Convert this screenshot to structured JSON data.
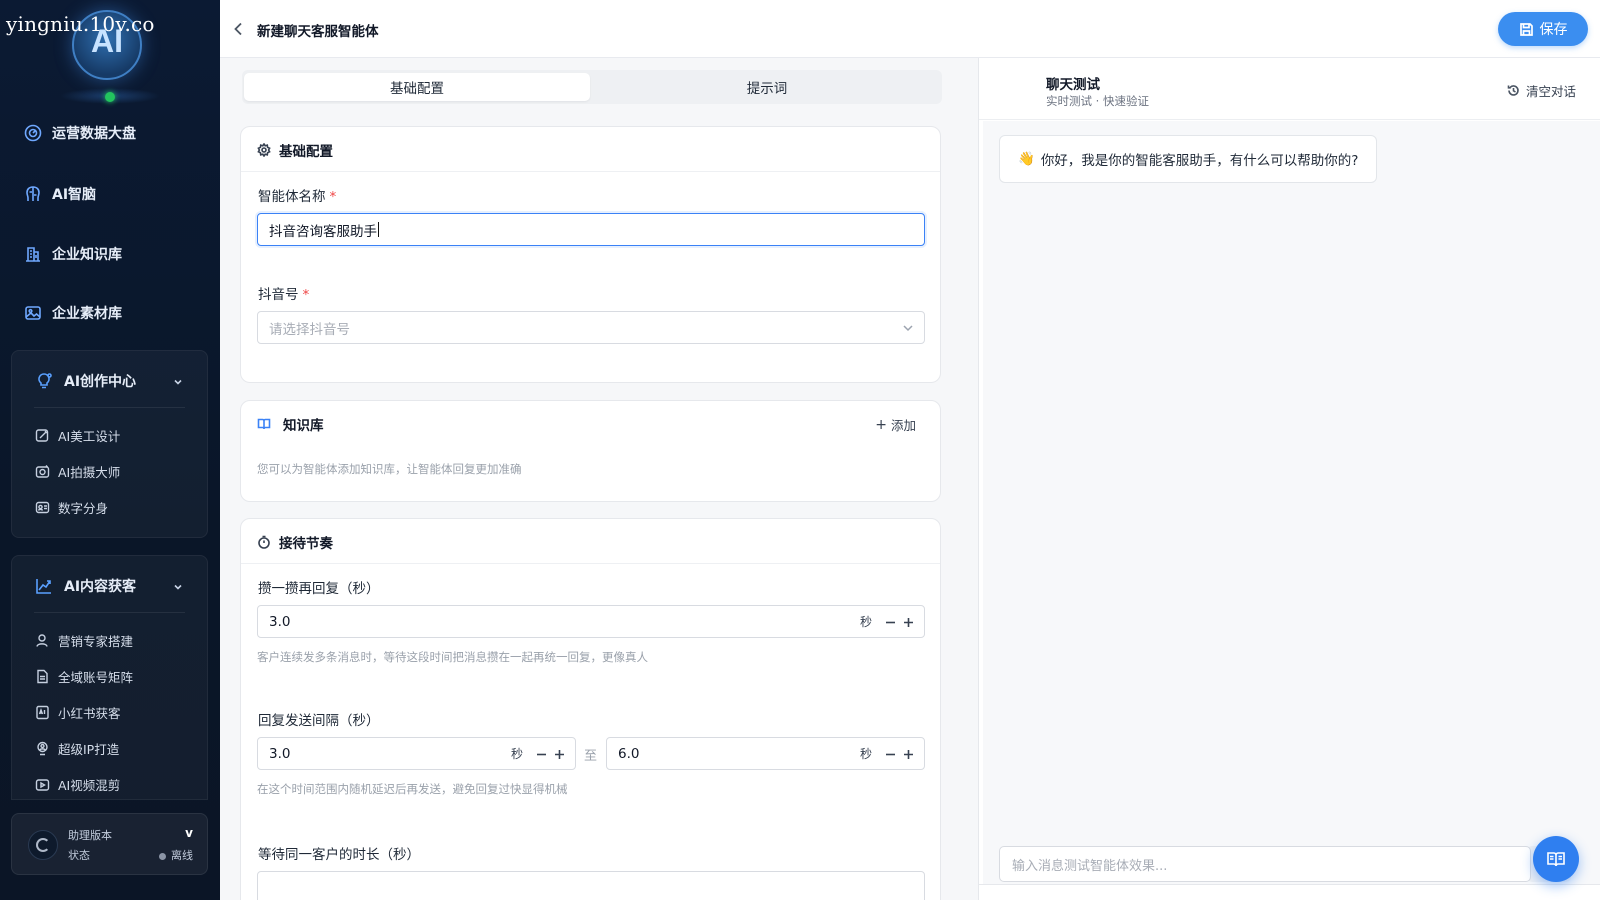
{
  "watermark": "yingniu.10v.co",
  "logo_text": "AI",
  "sidebar": {
    "items": [
      {
        "label": "运营数据大盘",
        "icon": "dashboard-icon"
      },
      {
        "label": "AI智脑",
        "icon": "brain-icon"
      },
      {
        "label": "企业知识库",
        "icon": "building-icon"
      },
      {
        "label": "企业素材库",
        "icon": "image-icon"
      }
    ],
    "groups": [
      {
        "label": "AI创作中心",
        "icon": "bulb-icon",
        "expanded": true,
        "items": [
          {
            "label": "AI美工设计",
            "icon": "design-icon"
          },
          {
            "label": "AI拍摄大师",
            "icon": "camera-icon"
          },
          {
            "label": "数字分身",
            "icon": "id-card-icon"
          }
        ]
      },
      {
        "label": "AI内容获客",
        "icon": "trend-icon",
        "expanded": true,
        "items": [
          {
            "label": "营销专家搭建",
            "icon": "user-icon"
          },
          {
            "label": "全域账号矩阵",
            "icon": "document-icon"
          },
          {
            "label": "小红书获客",
            "icon": "ai-doc-icon"
          },
          {
            "label": "超级IP打造",
            "icon": "monitor-icon"
          },
          {
            "label": "AI视频混剪",
            "icon": "video-icon"
          }
        ]
      }
    ],
    "assistant": {
      "version_label": "助理版本",
      "version_value": "v",
      "status_label": "状态",
      "status_value": "离线"
    }
  },
  "header": {
    "title": "新建聊天客服智能体",
    "save_label": "保存"
  },
  "tabs": [
    {
      "label": "基础配置",
      "active": true
    },
    {
      "label": "提示词",
      "active": false
    }
  ],
  "basic_config": {
    "title": "基础配置",
    "name_label": "智能体名称",
    "name_value": "抖音咨询客服助手",
    "douyin_label": "抖音号",
    "douyin_placeholder": "请选择抖音号",
    "required_mark": "*"
  },
  "knowledge": {
    "title": "知识库",
    "add_label": "添加",
    "hint": "您可以为智能体添加知识库，让智能体回复更加准确"
  },
  "rhythm": {
    "title": "接待节奏",
    "merge_label": "攒一攒再回复（秒）",
    "merge_value": "3.0",
    "merge_hint": "客户连续发多条消息时，等待这段时间把消息攒在一起再统一回复，更像真人",
    "interval_label": "回复发送间隔（秒）",
    "interval_min": "3.0",
    "interval_max": "6.0",
    "interval_to": "至",
    "interval_hint": "在这个时间范围内随机延迟后再发送，避免回复过快显得机械",
    "wait_label": "等待同一客户的时长（秒）",
    "unit": "秒"
  },
  "chat": {
    "title": "聊天测试",
    "subtitle": "实时测试 · 快速验证",
    "clear_label": "清空对话",
    "greeting_emoji": "👋",
    "greeting": "你好，我是你的智能客服助手，有什么可以帮助你的?",
    "input_placeholder": "输入消息测试智能体效果..."
  },
  "colors": {
    "sidebar_bg": "#0b1a33",
    "accent": "#3b8ef0",
    "required": "#ef4444",
    "online_dot": "#22c55e"
  }
}
